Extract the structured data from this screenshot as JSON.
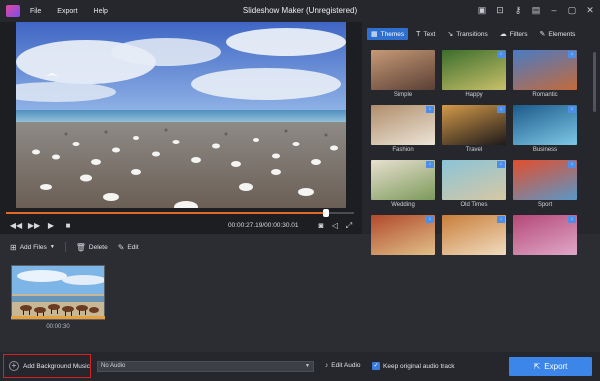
{
  "window": {
    "title": "Slideshow Maker (Unregistered)"
  },
  "menu": {
    "items": [
      {
        "label": "File"
      },
      {
        "label": "Export"
      },
      {
        "label": "Help"
      }
    ]
  },
  "window_controls": [
    {
      "icon": "save-icon"
    },
    {
      "icon": "cart-icon"
    },
    {
      "icon": "key-icon"
    },
    {
      "icon": "chat-icon"
    },
    {
      "icon": "minimize-icon"
    },
    {
      "icon": "maximize-icon"
    },
    {
      "icon": "close-icon"
    }
  ],
  "player": {
    "current_time": "00:00:27.19",
    "total_time": "00:00:30.01",
    "separator": "/",
    "progress_fraction": 0.92
  },
  "panel_tabs": [
    {
      "label": "Themes",
      "icon": "themes-icon",
      "active": true
    },
    {
      "label": "Text",
      "icon": "text-icon",
      "active": false
    },
    {
      "label": "Transitions",
      "icon": "transitions-icon",
      "active": false
    },
    {
      "label": "Filters",
      "icon": "filters-icon",
      "active": false
    },
    {
      "label": "Elements",
      "icon": "elements-icon",
      "active": false
    }
  ],
  "themes": [
    {
      "label": "Simple",
      "downloadable": false
    },
    {
      "label": "Happy",
      "downloadable": true
    },
    {
      "label": "Romantic",
      "downloadable": true
    },
    {
      "label": "Fashion",
      "downloadable": true
    },
    {
      "label": "Travel",
      "downloadable": true
    },
    {
      "label": "Business",
      "downloadable": true
    },
    {
      "label": "Wedding",
      "downloadable": true
    },
    {
      "label": "Old Times",
      "downloadable": true
    },
    {
      "label": "Sport",
      "downloadable": true
    },
    {
      "label": "",
      "downloadable": true
    },
    {
      "label": "",
      "downloadable": true
    },
    {
      "label": "",
      "downloadable": true
    }
  ],
  "toolbar": {
    "add_files": "Add Files",
    "delete": "Delete",
    "edit": "Edit"
  },
  "storyboard": {
    "clip_duration": "00:00:30"
  },
  "bottom": {
    "add_music": "Add Background Music",
    "audio_select": "No Audio",
    "edit_audio": "Edit Audio",
    "keep_original": "Keep original audio track",
    "export": "Export"
  },
  "colors": {
    "accent": "#3b86e8",
    "highlight_border": "#d42222",
    "progress": "#e46a2a"
  }
}
